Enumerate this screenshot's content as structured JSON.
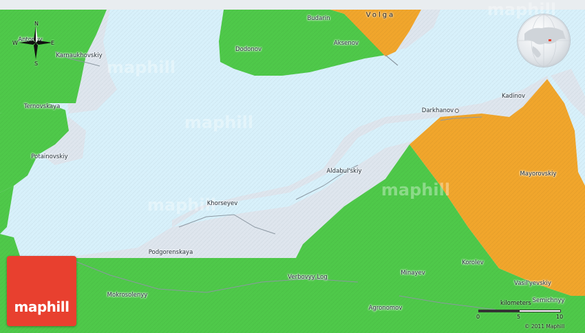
{
  "map": {
    "colors": {
      "water": "#d8f1fb",
      "shore": "#dfe6ee",
      "green": "#4fc94a",
      "green_dark": "#3fa93c",
      "orange": "#f1a62c",
      "road": "#8c98a2",
      "logo": "#e8402f"
    },
    "river_label": "Volga",
    "watermark": "maphill",
    "places": [
      {
        "name": "Antonov",
        "dot": false
      },
      {
        "name": "Karnaukhovskiy",
        "dot": false
      },
      {
        "name": "Budarin",
        "dot": false
      },
      {
        "name": "Dodonov",
        "dot": false
      },
      {
        "name": "Aksenov",
        "dot": false
      },
      {
        "name": "Ternovskaya",
        "dot": false
      },
      {
        "name": "Potainovskiy",
        "dot": false
      },
      {
        "name": "Kadinov",
        "dot": false
      },
      {
        "name": "Darkhanov",
        "dot": true
      },
      {
        "name": "Aldabul'skiy",
        "dot": false
      },
      {
        "name": "Mayorovskiy",
        "dot": false
      },
      {
        "name": "Khorseyev",
        "dot": false
      },
      {
        "name": "Podgorenskaya",
        "dot": false
      },
      {
        "name": "Korolev",
        "dot": false
      },
      {
        "name": "Minayev",
        "dot": false
      },
      {
        "name": "Verbovyy Log",
        "dot": false
      },
      {
        "name": "Vasil'yevskiy",
        "dot": false
      },
      {
        "name": "Mokrosolenyy",
        "dot": false
      },
      {
        "name": "Agronomov",
        "dot": false
      },
      {
        "name": "Semichnyy",
        "dot": false
      }
    ]
  },
  "compass": {
    "n": "N",
    "s": "S",
    "e": "E",
    "w": "W",
    "icon": "compass-rose-icon"
  },
  "globe": {
    "icon": "locator-globe-icon"
  },
  "logo": {
    "text": "maphill"
  },
  "scale": {
    "title": "kilometers",
    "ticks": [
      "0",
      "5",
      "10"
    ]
  },
  "copyright": "© 2011 Maphill"
}
